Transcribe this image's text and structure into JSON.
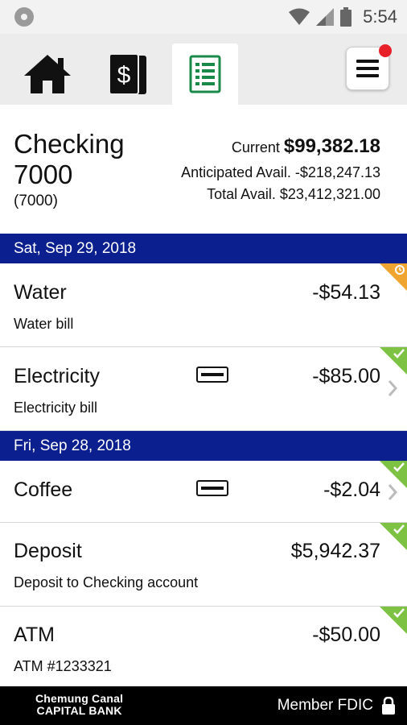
{
  "status_bar": {
    "time": "5:54"
  },
  "tabs": [
    {
      "name": "home",
      "icon": "home-icon"
    },
    {
      "name": "money",
      "icon": "money-icon"
    },
    {
      "name": "register",
      "icon": "register-icon",
      "active": true
    }
  ],
  "menu": {
    "icon": "hamburger-icon",
    "has_notification": true
  },
  "account": {
    "name": "Checking 7000",
    "number": "(7000)",
    "current_label": "Current",
    "current_value": "$99,382.18",
    "anticipated": "Anticipated Avail. -$218,247.13",
    "total": "Total Avail. $23,412,321.00"
  },
  "groups": [
    {
      "date": "Sat, Sep 29, 2018",
      "transactions": [
        {
          "name": "Water",
          "description": "Water bill",
          "amount": "-$54.13",
          "status": "pending"
        },
        {
          "name": "Electricity",
          "description": "Electricity bill",
          "amount": "-$85.00",
          "status": "cleared",
          "card": true,
          "chevron": true
        }
      ]
    },
    {
      "date": "Fri, Sep 28, 2018",
      "transactions": [
        {
          "name": "Coffee",
          "description": "",
          "amount": "-$2.04",
          "status": "cleared",
          "card": true,
          "chevron": true
        },
        {
          "name": "Deposit",
          "description": "Deposit to Checking account",
          "amount": "$5,942.37",
          "status": "cleared"
        },
        {
          "name": "ATM",
          "description": "ATM #1233321",
          "amount": "-$50.00",
          "status": "cleared"
        }
      ]
    }
  ],
  "footer": {
    "bank_line1": "Chemung Canal",
    "bank_line2": "CAPITAL BANK",
    "fdic": "Member FDIC"
  },
  "colors": {
    "date_bar": "#0b1f8f",
    "cleared": "#7dc242",
    "pending": "#f0a531",
    "register_icon": "#1a8a4a"
  }
}
